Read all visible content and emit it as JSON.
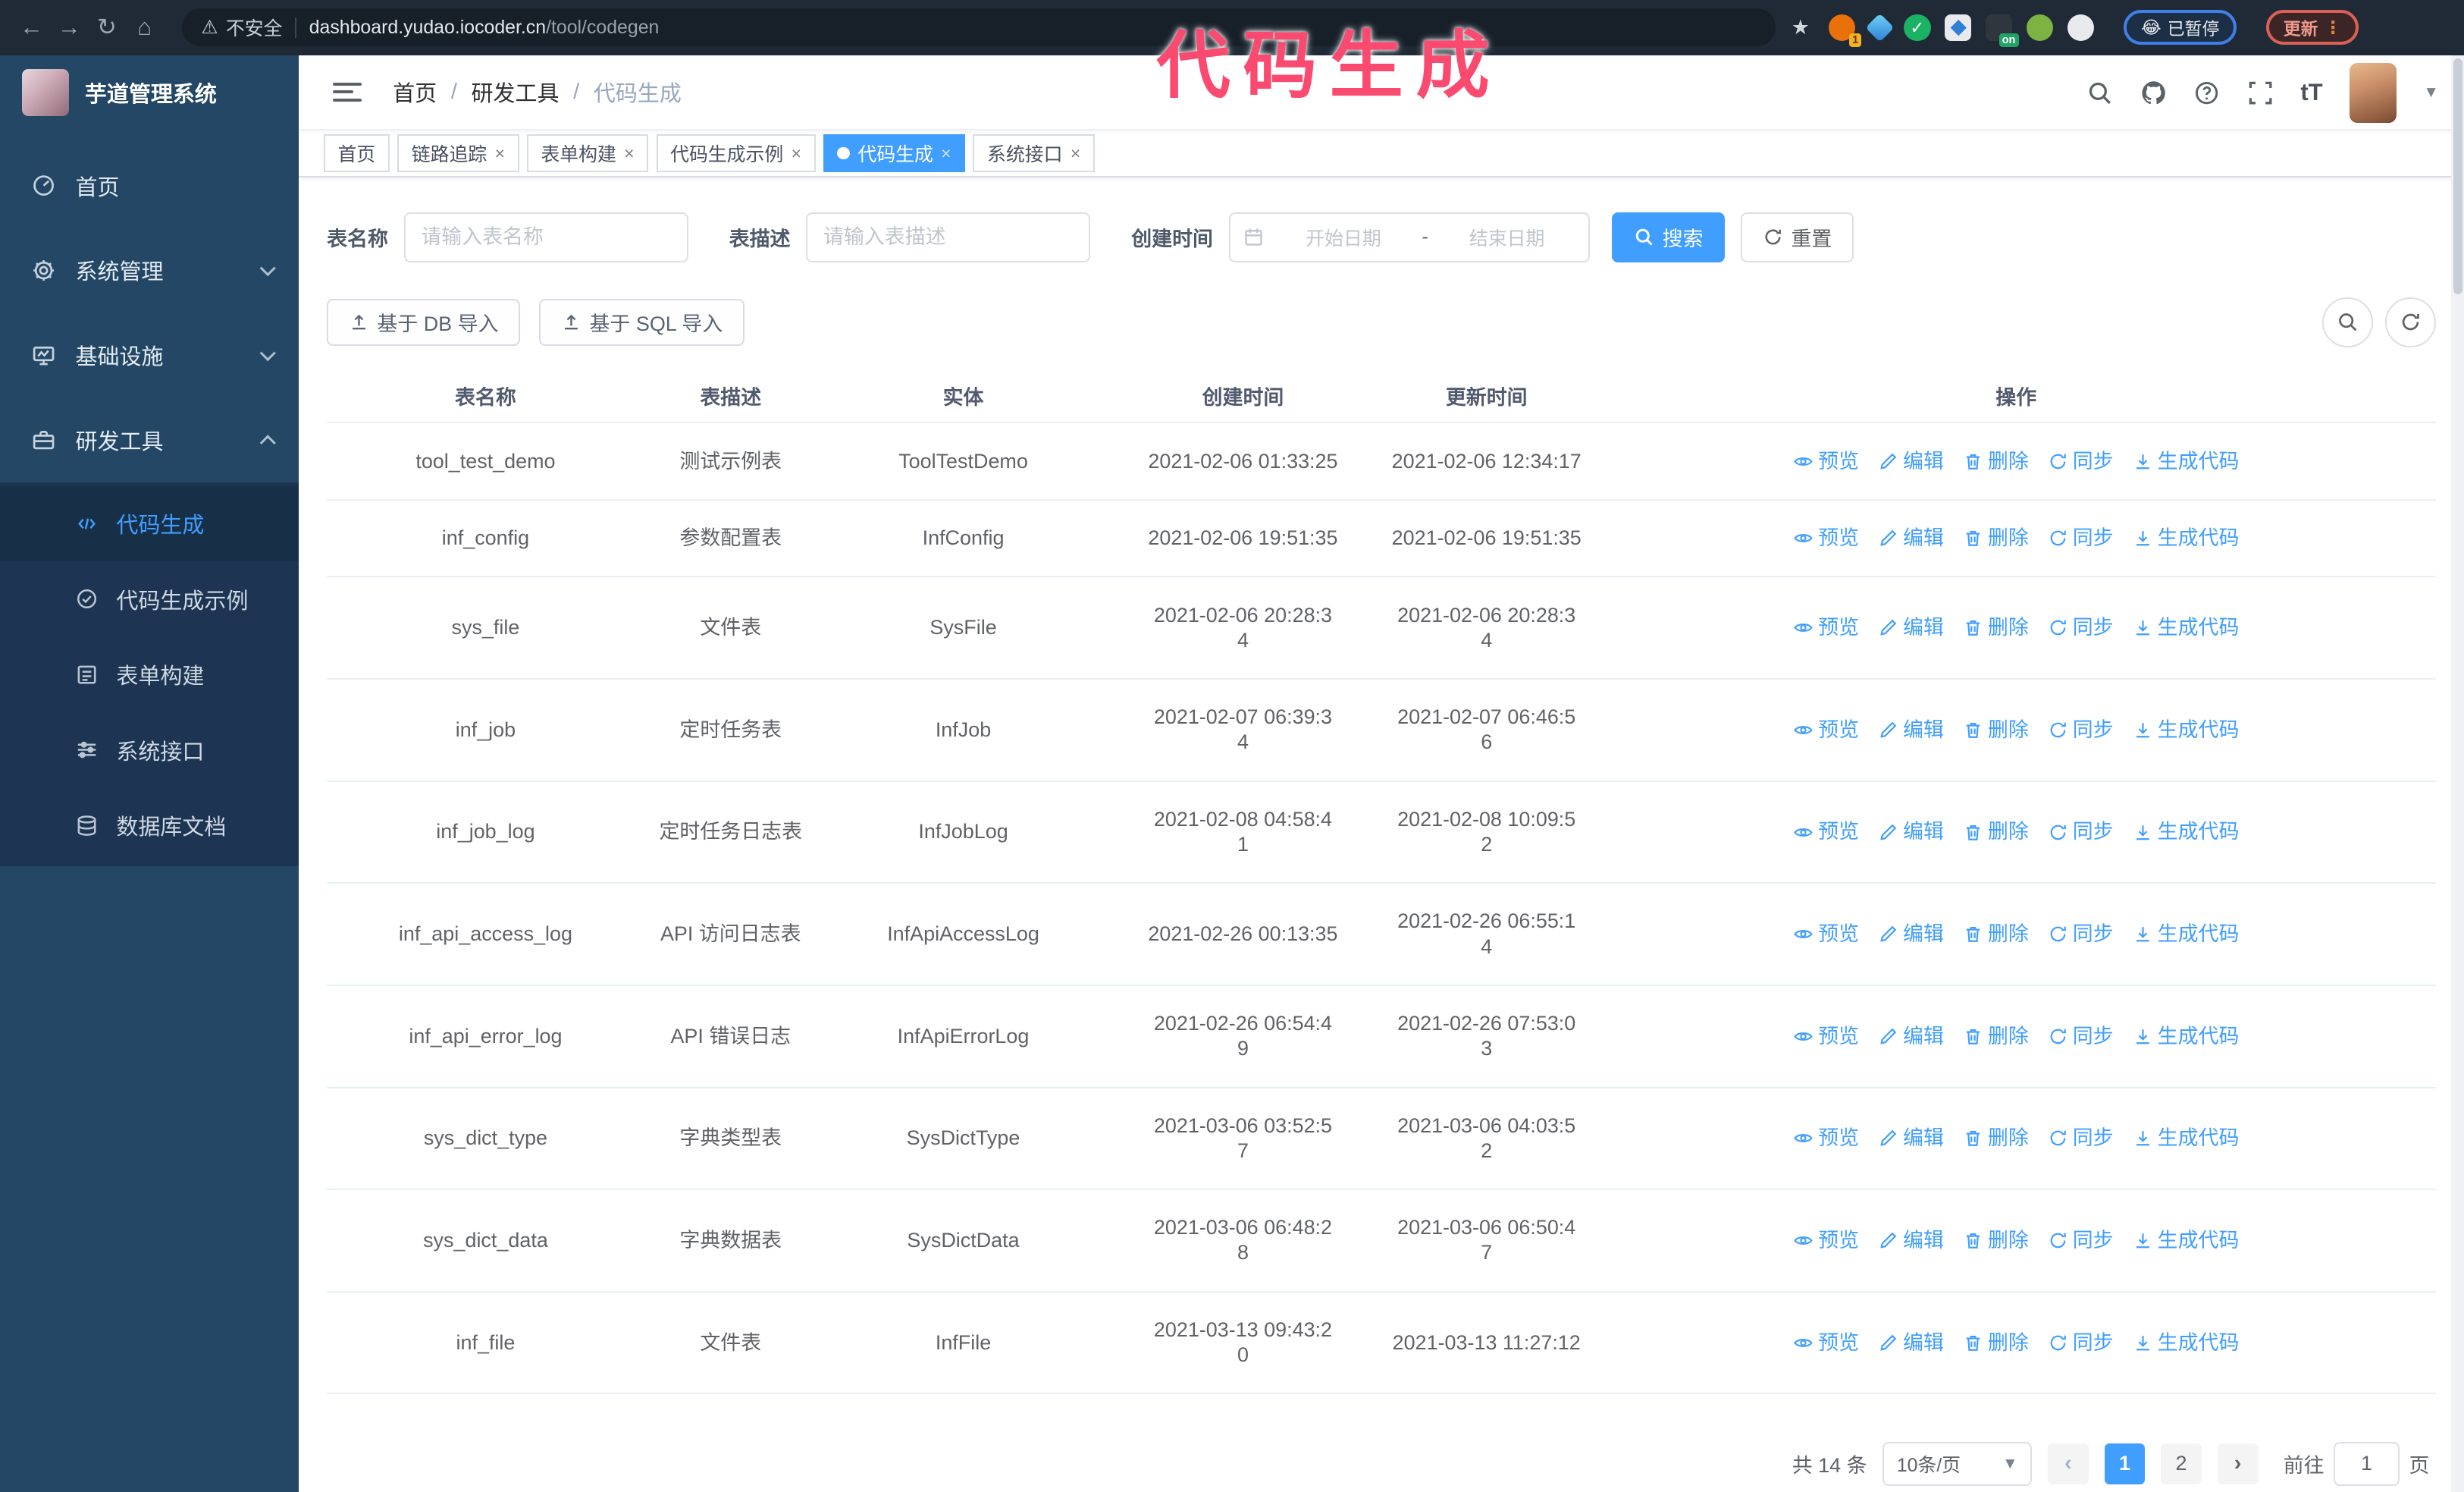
{
  "annotation": {
    "text": "代码生成"
  },
  "browser": {
    "insecure_label": "不安全",
    "url_host": "dashboard.yudao.iocoder.cn",
    "url_path": "/tool/codegen",
    "ext_badge_1": "1",
    "ext_badge_on": "on",
    "paused_emoji": "😂",
    "paused_label": "已暂停",
    "update_label": "更新",
    "update_dots": "⋮"
  },
  "sidebar": {
    "app_title": "芋道管理系统",
    "items": [
      {
        "label": "首页"
      },
      {
        "label": "系统管理"
      },
      {
        "label": "基础设施"
      },
      {
        "label": "研发工具"
      }
    ],
    "submenu": [
      {
        "label": "代码生成"
      },
      {
        "label": "代码生成示例"
      },
      {
        "label": "表单构建"
      },
      {
        "label": "系统接口"
      },
      {
        "label": "数据库文档"
      }
    ]
  },
  "header": {
    "breadcrumb": [
      "首页",
      "研发工具",
      "代码生成"
    ]
  },
  "tabs": [
    {
      "label": "首页",
      "closable": false,
      "active": false
    },
    {
      "label": "链路追踪",
      "closable": true,
      "active": false
    },
    {
      "label": "表单构建",
      "closable": true,
      "active": false
    },
    {
      "label": "代码生成示例",
      "closable": true,
      "active": false
    },
    {
      "label": "代码生成",
      "closable": true,
      "active": true
    },
    {
      "label": "系统接口",
      "closable": true,
      "active": false
    }
  ],
  "filters": {
    "table_name_label": "表名称",
    "table_name_placeholder": "请输入表名称",
    "table_desc_label": "表描述",
    "table_desc_placeholder": "请输入表描述",
    "create_time_label": "创建时间",
    "date_start_placeholder": "开始日期",
    "date_separator": "-",
    "date_end_placeholder": "结束日期",
    "search_label": "搜索",
    "reset_label": "重置"
  },
  "toolbar": {
    "import_db_label": "基于 DB 导入",
    "import_sql_label": "基于 SQL 导入"
  },
  "table": {
    "columns": [
      "表名称",
      "表描述",
      "实体",
      "创建时间",
      "更新时间",
      "操作"
    ],
    "actions": [
      "预览",
      "编辑",
      "删除",
      "同步",
      "生成代码"
    ],
    "rows": [
      {
        "name": "tool_test_demo",
        "desc": "测试示例表",
        "entity": "ToolTestDemo",
        "created": "2021-02-06 01:33:25",
        "updated": "2021-02-06 12:34:17"
      },
      {
        "name": "inf_config",
        "desc": "参数配置表",
        "entity": "InfConfig",
        "created": "2021-02-06 19:51:35",
        "updated": "2021-02-06 19:51:35"
      },
      {
        "name": "sys_file",
        "desc": "文件表",
        "entity": "SysFile",
        "created": "2021-02-06 20:28:3\n4",
        "updated": "2021-02-06 20:28:3\n4"
      },
      {
        "name": "inf_job",
        "desc": "定时任务表",
        "entity": "InfJob",
        "created": "2021-02-07 06:39:3\n4",
        "updated": "2021-02-07 06:46:5\n6"
      },
      {
        "name": "inf_job_log",
        "desc": "定时任务日志表",
        "entity": "InfJobLog",
        "created": "2021-02-08 04:58:4\n1",
        "updated": "2021-02-08 10:09:5\n2"
      },
      {
        "name": "inf_api_access_log",
        "desc": "API 访问日志表",
        "entity": "InfApiAccessLog",
        "created": "2021-02-26 00:13:35",
        "updated": "2021-02-26 06:55:1\n4"
      },
      {
        "name": "inf_api_error_log",
        "desc": "API 错误日志",
        "entity": "InfApiErrorLog",
        "created": "2021-02-26 06:54:4\n9",
        "updated": "2021-02-26 07:53:0\n3"
      },
      {
        "name": "sys_dict_type",
        "desc": "字典类型表",
        "entity": "SysDictType",
        "created": "2021-03-06 03:52:5\n7",
        "updated": "2021-03-06 04:03:5\n2"
      },
      {
        "name": "sys_dict_data",
        "desc": "字典数据表",
        "entity": "SysDictData",
        "created": "2021-03-06 06:48:2\n8",
        "updated": "2021-03-06 06:50:4\n7"
      },
      {
        "name": "inf_file",
        "desc": "文件表",
        "entity": "InfFile",
        "created": "2021-03-13 09:43:2\n0",
        "updated": "2021-03-13 11:27:12"
      }
    ]
  },
  "pagination": {
    "total_label": "共 14 条",
    "page_size": "10条/页",
    "prev": "‹",
    "next": "›",
    "pages": [
      "1",
      "2"
    ],
    "goto_label": "前往",
    "goto_value": "1",
    "page_unit": "页"
  },
  "colors": {
    "accent": "#409EFF",
    "annotation": "#fb4a6f",
    "sidebar_bg": "#234764",
    "submenu_bg": "#1d3553",
    "browser_bar_bg": "#1f2a36"
  }
}
